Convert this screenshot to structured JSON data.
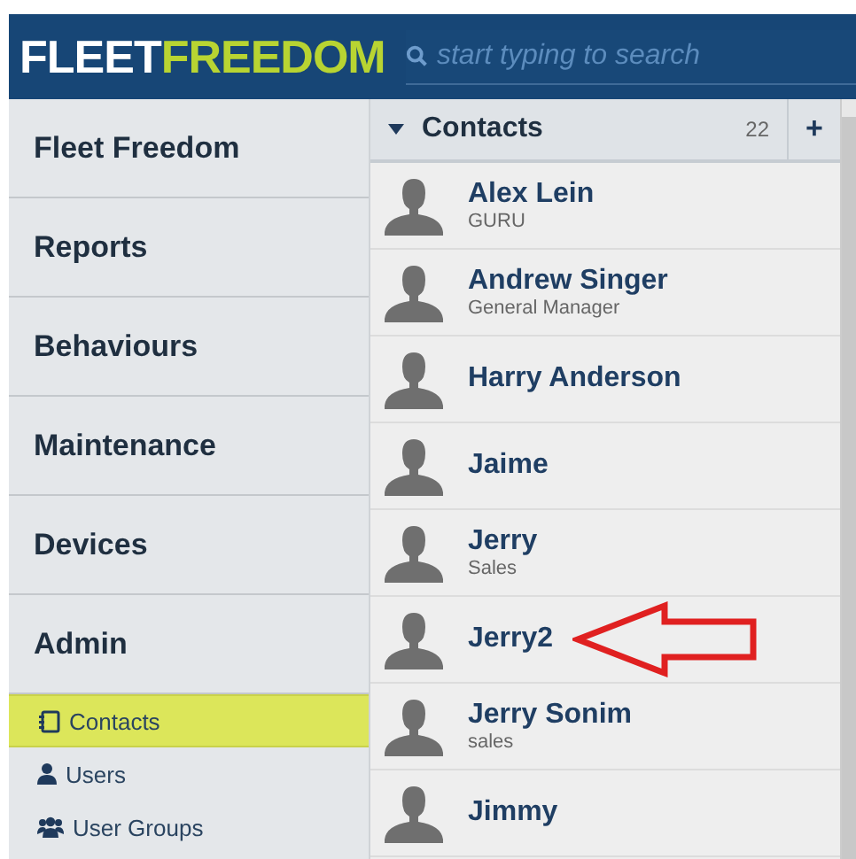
{
  "header": {
    "logo_left": "FLEET",
    "logo_right": "FREEDOM",
    "search": {
      "placeholder": "start typing to search"
    }
  },
  "sidebar": {
    "sections": [
      {
        "label": "Fleet Freedom"
      },
      {
        "label": "Reports"
      },
      {
        "label": "Behaviours"
      },
      {
        "label": "Maintenance"
      },
      {
        "label": "Devices"
      },
      {
        "label": "Admin"
      }
    ],
    "items": [
      {
        "label": "Contacts",
        "kind": "contacts",
        "selected": true
      },
      {
        "label": "Users",
        "kind": "user",
        "selected": false
      },
      {
        "label": "User Groups",
        "kind": "group",
        "selected": false
      }
    ]
  },
  "contacts": {
    "title": "Contacts",
    "count": "22",
    "add": "+",
    "expanded": true,
    "rows": [
      {
        "name": "Alex Lein",
        "subtitle": "GURU"
      },
      {
        "name": "Andrew Singer",
        "subtitle": "General Manager"
      },
      {
        "name": "Harry Anderson"
      },
      {
        "name": "Jaime"
      },
      {
        "name": "Jerry",
        "subtitle": "Sales"
      },
      {
        "name": "Jerry2",
        "annotated": true
      },
      {
        "name": "Jerry Sonim",
        "subtitle": "sales"
      },
      {
        "name": "Jimmy"
      }
    ]
  }
}
